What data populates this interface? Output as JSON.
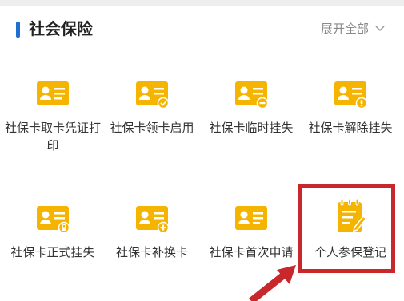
{
  "section": {
    "title": "社会保险",
    "expand_label": "展开全部"
  },
  "services": [
    {
      "label": "社保卡取卡凭证打印",
      "icon": "id-card-icon"
    },
    {
      "label": "社保卡领卡启用",
      "icon": "id-card-check-icon"
    },
    {
      "label": "社保卡临时挂失",
      "icon": "id-card-minus-icon"
    },
    {
      "label": "社保卡解除挂失",
      "icon": "id-card-unlock-icon"
    },
    {
      "label": "社保卡正式挂失",
      "icon": "id-card-lock-icon"
    },
    {
      "label": "社保卡补换卡",
      "icon": "id-card-add-icon"
    },
    {
      "label": "社保卡首次申请",
      "icon": "id-card-icon"
    },
    {
      "label": "个人参保登记",
      "icon": "notepad-pen-icon"
    }
  ],
  "colors": {
    "accent": "#1f6fd1",
    "icon_yellow": "#f5b400",
    "highlight_red": "#c8272b"
  }
}
